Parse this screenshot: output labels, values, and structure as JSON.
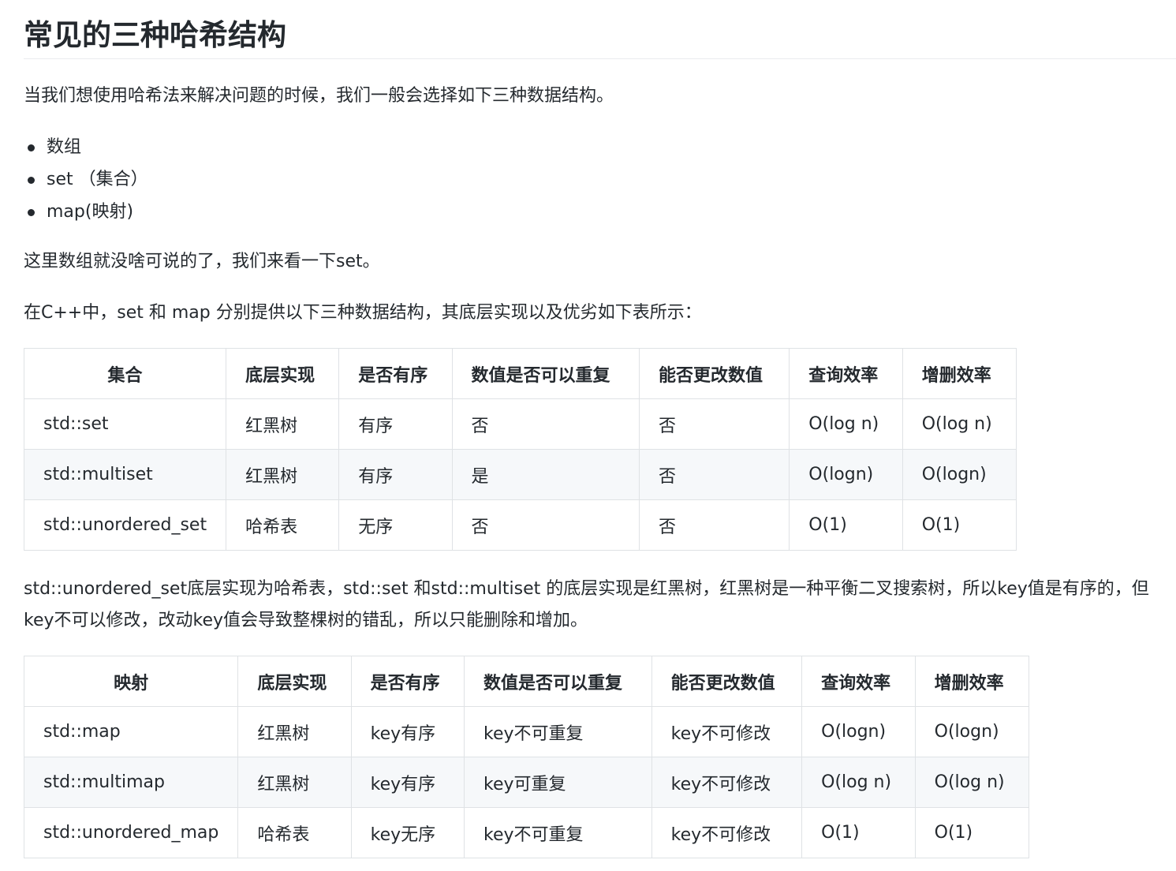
{
  "title": "常见的三种哈希结构",
  "intro": "当我们想使用哈希法来解决问题的时候，我们一般会选择如下三种数据结构。",
  "list": [
    "数组",
    "set （集合）",
    "map(映射)"
  ],
  "p2": "这里数组就没啥可说的了，我们来看一下set。",
  "p3": "在C++中，set 和 map 分别提供以下三种数据结构，其底层实现以及优劣如下表所示：",
  "table1": {
    "headers": [
      "集合",
      "底层实现",
      "是否有序",
      "数值是否可以重复",
      "能否更改数值",
      "查询效率",
      "增删效率"
    ],
    "rows": [
      [
        "std::set",
        "红黑树",
        "有序",
        "否",
        "否",
        "O(log n)",
        "O(log n)"
      ],
      [
        "std::multiset",
        "红黑树",
        "有序",
        "是",
        "否",
        "O(logn)",
        "O(logn)"
      ],
      [
        "std::unordered_set",
        "哈希表",
        "无序",
        "否",
        "否",
        "O(1)",
        "O(1)"
      ]
    ]
  },
  "p4": "std::unordered_set底层实现为哈希表，std::set 和std::multiset 的底层实现是红黑树，红黑树是一种平衡二叉搜索树，所以key值是有序的，但key不可以修改，改动key值会导致整棵树的错乱，所以只能删除和增加。",
  "table2": {
    "headers": [
      "映射",
      "底层实现",
      "是否有序",
      "数值是否可以重复",
      "能否更改数值",
      "查询效率",
      "增删效率"
    ],
    "rows": [
      [
        "std::map",
        "红黑树",
        "key有序",
        "key不可重复",
        "key不可修改",
        "O(logn)",
        "O(logn)"
      ],
      [
        "std::multimap",
        "红黑树",
        "key有序",
        "key可重复",
        "key不可修改",
        "O(log n)",
        "O(log n)"
      ],
      [
        "std::unordered_map",
        "哈希表",
        "key无序",
        "key不可重复",
        "key不可修改",
        "O(1)",
        "O(1)"
      ]
    ]
  }
}
